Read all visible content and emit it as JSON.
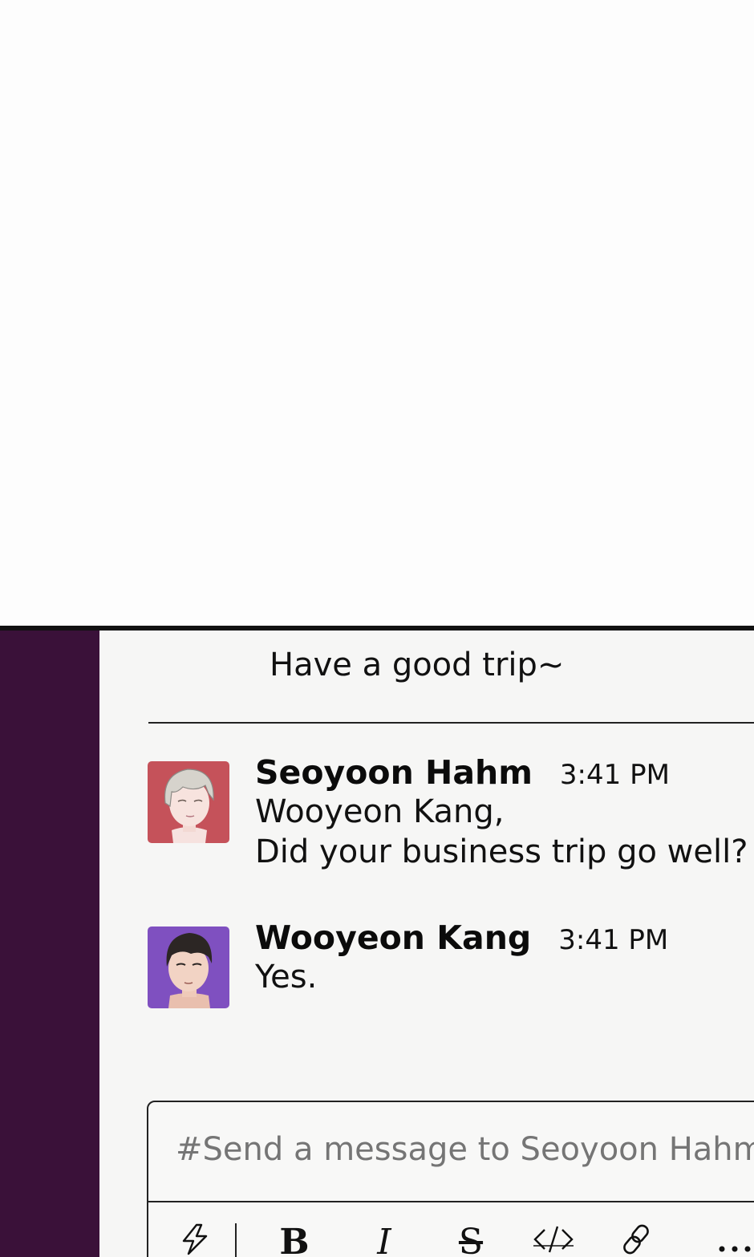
{
  "previous_message": {
    "text": "Have a good trip~"
  },
  "messages": [
    {
      "sender": "Seoyoon Hahm",
      "time": "3:41 PM",
      "lines": [
        "Wooyeon Kang,",
        "Did your business trip go well?"
      ],
      "avatar_bg": "#c5525a"
    },
    {
      "sender": "Wooyeon Kang",
      "time": "3:41 PM",
      "lines": [
        "Yes."
      ],
      "avatar_bg": "#7f50c0"
    }
  ],
  "composer": {
    "placeholder": "#Send a message to Seoyoon Hahm",
    "toolbar": [
      {
        "name": "shortcut",
        "icon": "lightning-icon"
      },
      {
        "name": "bold",
        "glyph": "B"
      },
      {
        "name": "italic",
        "glyph": "I"
      },
      {
        "name": "strikethrough",
        "glyph": "S"
      },
      {
        "name": "code",
        "icon": "code-icon"
      },
      {
        "name": "link",
        "icon": "link-icon"
      },
      {
        "name": "more",
        "icon": "more-icon"
      }
    ]
  },
  "colors": {
    "sidebar": "#3a1139",
    "background": "#f6f6f5",
    "text": "#111111",
    "placeholder": "#8a8a8a"
  }
}
